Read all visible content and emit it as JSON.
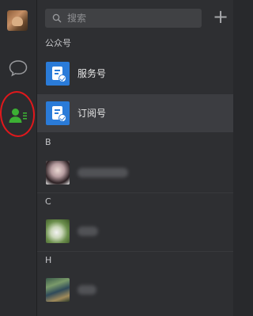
{
  "search": {
    "placeholder": "搜索",
    "add_label": "+"
  },
  "sections": {
    "official": "公众号",
    "b": "B",
    "c": "C",
    "h": "H"
  },
  "official_accounts": [
    {
      "label": "服务号",
      "icon": "service-account-icon"
    },
    {
      "label": "订阅号",
      "icon": "subscription-account-icon",
      "selected": true
    }
  ],
  "colors": {
    "accent_blue": "#2a7bd8",
    "contacts_green": "#3cb034",
    "highlight_red": "#e0181c"
  }
}
